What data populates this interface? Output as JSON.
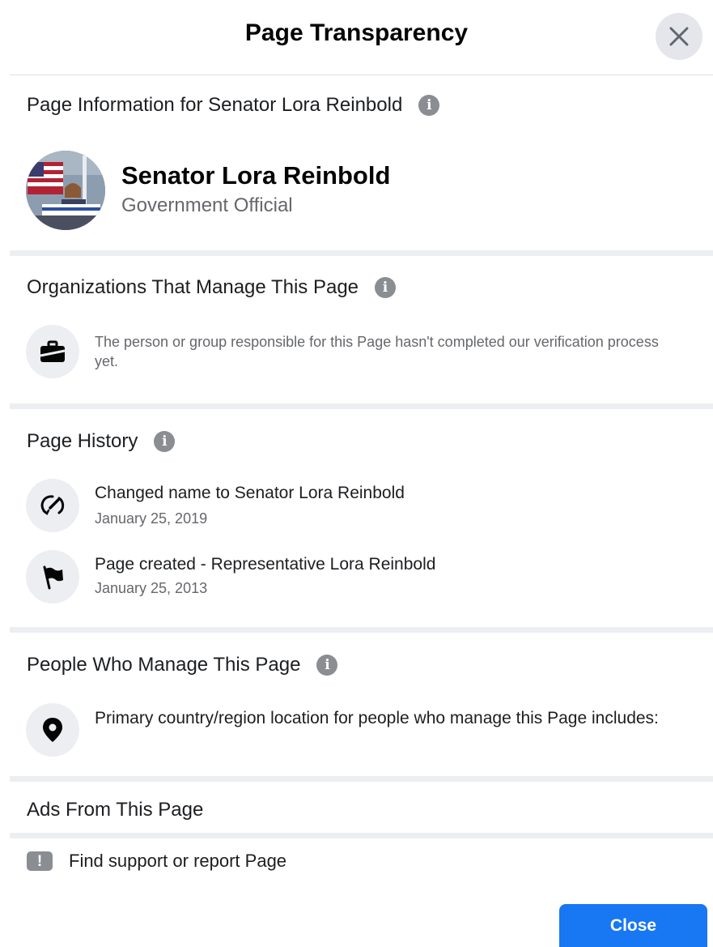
{
  "dialog": {
    "title": "Page Transparency",
    "close_button_label": "Close"
  },
  "page_info": {
    "heading": "Page Information for Senator Lora Reinbold",
    "name": "Senator Lora Reinbold",
    "category": "Government Official"
  },
  "organizations": {
    "heading": "Organizations That Manage This Page",
    "verification_text": "The person or group responsible for this Page hasn't completed our verification process yet."
  },
  "history": {
    "heading": "Page History",
    "items": [
      {
        "title": "Changed name to Senator Lora Reinbold",
        "date": "January 25, 2019",
        "icon": "name-change-icon"
      },
      {
        "title": "Page created - Representative Lora Reinbold",
        "date": "January 25, 2013",
        "icon": "flag-icon"
      }
    ]
  },
  "managers": {
    "heading": "People Who Manage This Page",
    "location_text": "Primary country/region location for people who manage this Page includes:"
  },
  "ads": {
    "heading": "Ads From This Page"
  },
  "report": {
    "label": "Find support or report Page"
  },
  "colors": {
    "accent": "#1877f2",
    "icon_bg": "#eceef2",
    "muted_text": "#65676b"
  }
}
